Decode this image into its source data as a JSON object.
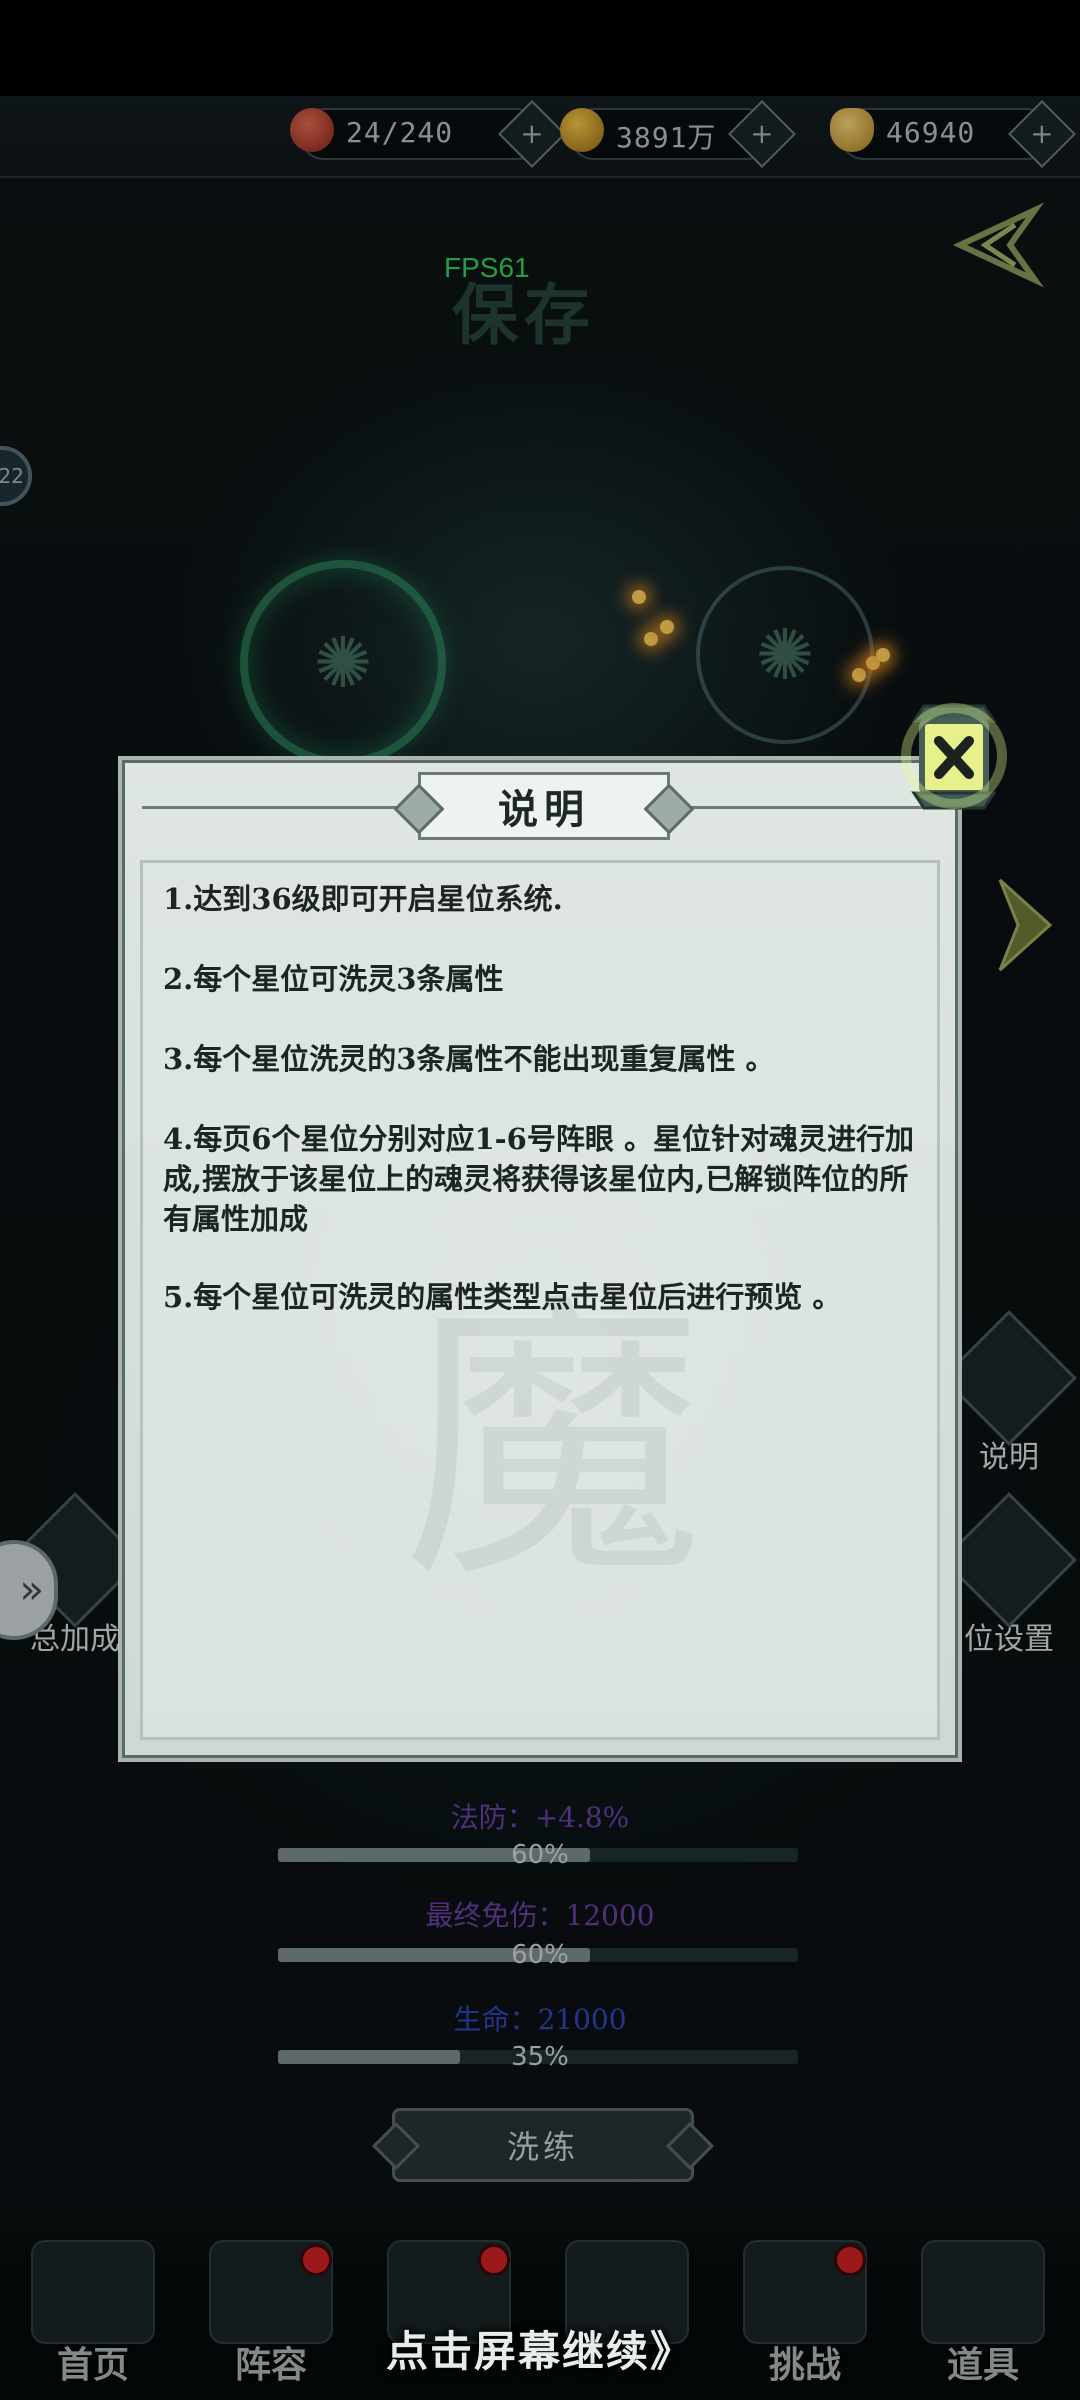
{
  "status_bar": {},
  "resources": [
    {
      "icon": "spirit-orb-icon",
      "value": "24/240",
      "color": "#b33a2c"
    },
    {
      "icon": "gold-coin-icon",
      "value": "3891万",
      "color": "#d9a126"
    },
    {
      "icon": "ingot-icon",
      "value": "46940",
      "color": "#e0b04a"
    }
  ],
  "fps_label": "FPS61",
  "background_title": "保存",
  "side_badge": "22",
  "side_buttons": {
    "info": "说明",
    "setting": "位设置",
    "total_bonus": "总加成"
  },
  "dialog": {
    "title": "说明",
    "rules": [
      "1.达到36级即可开启星位系统.",
      "2.每个星位可洗灵3条属性",
      "3.每个星位洗灵的3条属性不能出现重复属性 。",
      "4.每页6个星位分别对应1-6号阵眼 。星位针对魂灵进行加成,摆放于该星位上的魂灵将获得该星位内,已解锁阵位的所有属性加成",
      "5.每个星位可洗灵的属性类型点击星位后进行预览 。"
    ],
    "watermark": "魔"
  },
  "stats": [
    {
      "label": "法防：+4.8%",
      "percent_text": "60%",
      "fill": 0.6,
      "color": "#6b3fa6"
    },
    {
      "label": "最终免伤：12000",
      "percent_text": "60%",
      "fill": 0.6,
      "color": "#6b3fa6"
    },
    {
      "label": "生命：21000",
      "percent_text": "35%",
      "fill": 0.35,
      "color": "#2f46b8"
    }
  ],
  "refine_button": "洗练",
  "bottom_nav": [
    {
      "label": "首页",
      "icon": "home-icon",
      "badge": false
    },
    {
      "label": "阵容",
      "icon": "lineup-icon",
      "badge": true
    },
    {
      "label": "",
      "icon": "weapon-icon",
      "badge": true
    },
    {
      "label": "",
      "icon": "crossed-swords-icon",
      "badge": false
    },
    {
      "label": "挑战",
      "icon": "scroll-icon",
      "badge": true
    },
    {
      "label": "道具",
      "icon": "bag-icon",
      "badge": false
    }
  ],
  "continue_hint": "点击屏幕继续》"
}
